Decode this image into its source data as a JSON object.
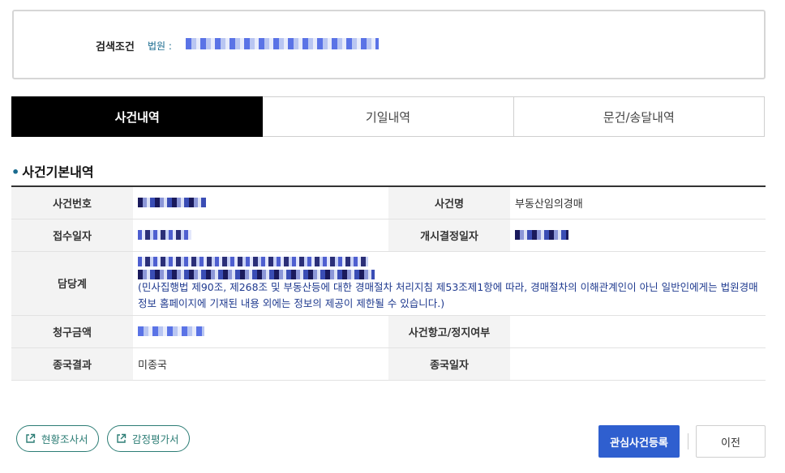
{
  "search": {
    "condition_label": "검색조건",
    "court_label": "법원 :"
  },
  "tabs": [
    {
      "label": "사건내역",
      "active": true
    },
    {
      "label": "기일내역",
      "active": false
    },
    {
      "label": "문건/송달내역",
      "active": false
    }
  ],
  "section": {
    "title": "사건기본내역"
  },
  "table": {
    "case_number_label": "사건번호",
    "case_name_label": "사건명",
    "case_name_value": "부동산임의경매",
    "received_date_label": "접수일자",
    "start_decision_label": "개시결정일자",
    "department_label": "담당계",
    "notice": "(민사집행법 제90조, 제268조 및 부동산등에 대한 경매절차 처리지침 제53조제1항에 따라, 경매절차의 이해관계인이 아닌 일반인에게는 법원경매정보 홈페이지에 기재된 내용 외에는 정보의 제공이 제한될 수 있습니다.)",
    "claim_amount_label": "청구금액",
    "appeal_label": "사건항고/정지여부",
    "final_result_label": "종국결과",
    "final_result_value": "미종국",
    "final_date_label": "종국일자"
  },
  "buttons": {
    "status_report": "현황조사서",
    "appraisal_report": "감정평가서",
    "register_interest": "관심사건등록",
    "previous": "이전"
  },
  "colors": {
    "accent_teal": "#2c7d75",
    "primary_blue": "#2f5fcf",
    "notice_blue": "#1f3a8f",
    "tab_active_bg": "#000000"
  }
}
